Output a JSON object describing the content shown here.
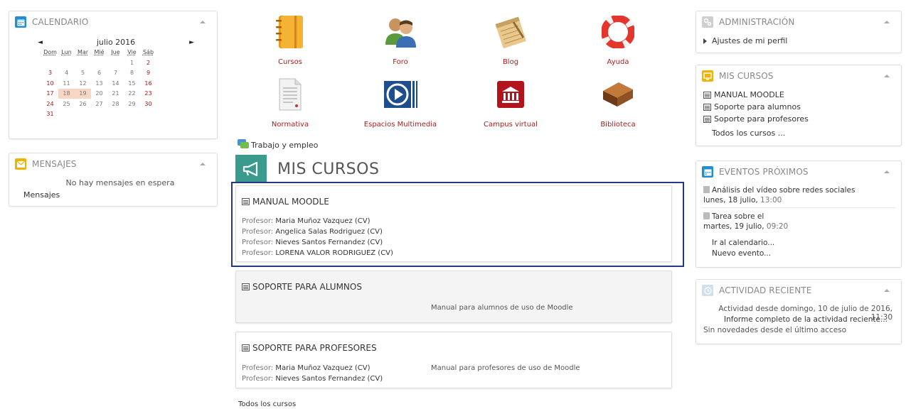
{
  "calendar": {
    "title": "CALENDARIO",
    "month": "julio 2016",
    "prev": "◄",
    "next": "►",
    "weekdays": [
      "Dom",
      "Lun",
      "Mar",
      "Mié",
      "Jue",
      "Vie",
      "Sáb"
    ],
    "weeks": [
      [
        "",
        "",
        "",
        "",
        "",
        "1",
        "2"
      ],
      [
        "3",
        "4",
        "5",
        "6",
        "7",
        "8",
        "9"
      ],
      [
        "10",
        "11",
        "12",
        "13",
        "14",
        "15",
        "16"
      ],
      [
        "17",
        "18",
        "19",
        "20",
        "21",
        "22",
        "23"
      ],
      [
        "24",
        "25",
        "26",
        "27",
        "28",
        "29",
        "30"
      ],
      [
        "31",
        "",
        "",
        "",
        "",
        "",
        ""
      ]
    ],
    "event_days": [
      "18",
      "19"
    ],
    "colors": {
      "weekend": "#b01111",
      "event_bg": "#f8d6c6",
      "icon": "#1f8fd0"
    }
  },
  "messages": {
    "title": "MENSAJES",
    "empty_text": "No hay mensajes en espera",
    "link": "Mensajes",
    "icon_color": "#f0b400"
  },
  "tiles": [
    {
      "label": "Cursos",
      "icon": "notebook-icon"
    },
    {
      "label": "Foro",
      "icon": "people-icon"
    },
    {
      "label": "Blog",
      "icon": "notepad-icon"
    },
    {
      "label": "Ayuda",
      "icon": "lifebuoy-icon"
    },
    {
      "label": "Normativa",
      "icon": "document-icon"
    },
    {
      "label": "Espacios Multimedia",
      "icon": "play-icon"
    },
    {
      "label": "Campus virtual",
      "icon": "bank-icon"
    },
    {
      "label": "Biblioteca",
      "icon": "books-icon"
    }
  ],
  "trabajo": "Trabajo y empleo",
  "main": {
    "title": "MIS CURSOS",
    "icon_color": "#3a9a8e",
    "courses": [
      {
        "name": "MANUAL MOODLE",
        "teacher_prefix": "Profesor: ",
        "teachers": [
          "Maria Muñoz Vazquez (CV)",
          "Angelica Salas Rodriguez (CV)",
          "Nieves Santos Fernandez (CV)",
          "LORENA VALOR RODRIGUEZ (CV)"
        ]
      },
      {
        "name": "SOPORTE PARA ALUMNOS",
        "description": "Manual para alumnos de uso de Moodle"
      },
      {
        "name": "SOPORTE PARA PROFESORES",
        "teacher_prefix": "Profesor: ",
        "teachers": [
          "Maria Muñoz Vazquez (CV)",
          "Nieves Santos Fernandez (CV)"
        ],
        "description": "Manual para profesores de uso de Moodle"
      }
    ],
    "all_courses": "Todos los cursos"
  },
  "admin": {
    "title": "ADMINISTRACIÓN",
    "item": "Ajustes de mi perfil",
    "icon_color": "#cfcfcf"
  },
  "my_courses": {
    "title": "MIS CURSOS",
    "items": [
      "MANUAL MOODLE",
      "Soporte para alumnos",
      "Soporte para profesores"
    ],
    "all": "Todos los cursos ...",
    "icon_color": "#f0b400"
  },
  "events": {
    "title": "EVENTOS PRÓXIMOS",
    "icon_color": "#1f8fd0",
    "items": [
      {
        "name": "Análisis del vídeo sobre redes sociales",
        "date": "lunes, 18 julio,",
        "time": " 13:00"
      },
      {
        "name": "Tarea sobre el",
        "date": "martes, 19 julio,",
        "time": " 09:20"
      }
    ],
    "goto_calendar": "Ir al calendario...",
    "new_event": "Nuevo evento..."
  },
  "activity": {
    "title": "ACTIVIDAD RECIENTE",
    "icon_color": "#cfe0ea",
    "since": "Actividad desde domingo, 10 de julio de 2016, 11:30",
    "report": "Informe completo de la actividad reciente...",
    "none": "Sin novedades desde el último acceso"
  }
}
